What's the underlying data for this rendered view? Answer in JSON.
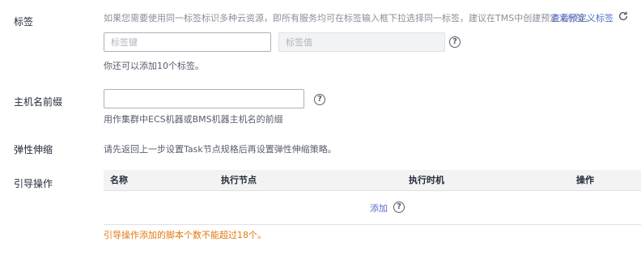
{
  "tags": {
    "label": "标签",
    "description": "如果您需要使用同一标签标识多种云资源，即所有服务均可在标签输入框下拉选择同一标签，建议在TMS中创建预定义标签。",
    "view_link": "查看预定义标签",
    "key_placeholder": "标签键",
    "value_placeholder": "标签值",
    "help": "?",
    "remaining": "你还可以添加10个标签。"
  },
  "hostname": {
    "label": "主机名前缀",
    "value": "",
    "help": "?",
    "hint": "用作集群中ECS机器或BMS机器主机名的前缀"
  },
  "autoscale": {
    "label": "弹性伸缩",
    "text": "请先返回上一步设置Task节点规格后再设置弹性伸缩策略。"
  },
  "bootstrap": {
    "label": "引导操作",
    "columns": [
      "名称",
      "执行节点",
      "执行时机",
      "操作"
    ],
    "add_link": "添加",
    "help": "?",
    "warning": "引导操作添加的脚本个数不能超过18个。"
  }
}
